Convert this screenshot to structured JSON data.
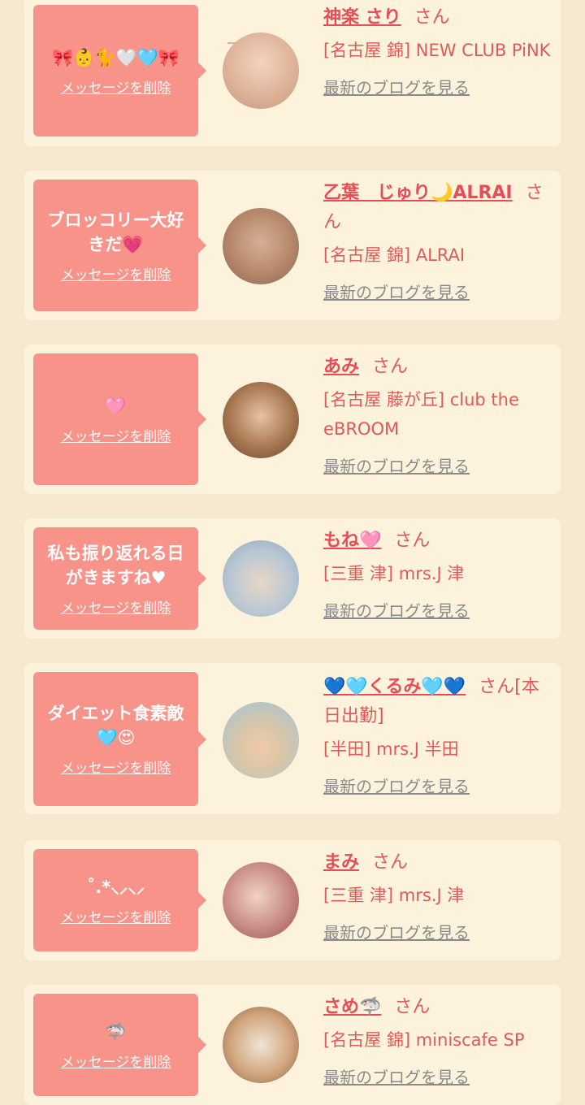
{
  "entries": [
    {
      "message": "🎀👶🐈🤍🩵🎀",
      "delete": "メッセージを削除",
      "name": "神楽 さり",
      "suffix": "さん",
      "shop": "[名古屋 錦] NEW CLUB PiNK",
      "blog": "最新のブログを見る",
      "avatar": "#e2b9a0"
    },
    {
      "message": "ブロッコリー大好きだ💗",
      "delete": "メッセージを削除",
      "name": "乙葉　じゅり🌙ALRAI",
      "suffix": "さん",
      "shop": "[名古屋 錦] ALRAI",
      "blog": "最新のブログを見る",
      "avatar": "#b98b6d"
    },
    {
      "message": "🩷",
      "delete": "メッセージを削除",
      "name": "あみ",
      "suffix": "さん",
      "shop": "[名古屋 藤が丘] club the eBROOM",
      "blog": "最新のブログを見る",
      "avatar": "#a77750"
    },
    {
      "message": "私も振り返れる日がきますね♥",
      "delete": "メッセージを削除",
      "name": "もね🩷",
      "suffix": "さん",
      "shop": "[三重 津] mrs.J 津",
      "blog": "最新のブログを見る",
      "avatar": "#b9c7d4"
    },
    {
      "message": "ダイエット食素敵🩵😍",
      "delete": "メッセージを削除",
      "name": "💙🩵くるみ🩵💙",
      "suffix": "さん[本日出勤]",
      "shop": "[半田] mrs.J 半田",
      "blog": "最新のブログを見る",
      "avatar": "#9fc4d8"
    },
    {
      "message": "˚.*⸜⸝⸜⸝",
      "delete": "メッセージを削除",
      "name": "まみ",
      "suffix": "さん",
      "shop": "[三重 津] mrs.J 津",
      "blog": "最新のブログを見る",
      "avatar": "#c78a85"
    },
    {
      "message": "🦈",
      "delete": "メッセージを削除",
      "name": "さめ🦈",
      "suffix": "さん",
      "shop": "[名古屋 錦] miniscafe SP",
      "blog": "最新のブログを見る",
      "avatar": "#d2a77f"
    }
  ]
}
